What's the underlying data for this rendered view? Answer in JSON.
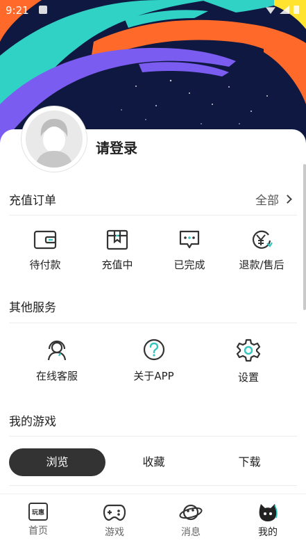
{
  "status_bar": {
    "time": "9:21"
  },
  "profile": {
    "login_text": "请登录",
    "avatar_icon": "default-avatar-icon"
  },
  "orders": {
    "title": "充值订单",
    "all_label": "全部",
    "items": [
      {
        "label": "待付款",
        "icon": "wallet-icon"
      },
      {
        "label": "充值中",
        "icon": "package-icon"
      },
      {
        "label": "已完成",
        "icon": "chat-dots-icon"
      },
      {
        "label": "退款/售后",
        "icon": "yuan-refund-icon"
      }
    ]
  },
  "services": {
    "title": "其他服务",
    "items": [
      {
        "label": "在线客服",
        "icon": "headset-icon"
      },
      {
        "label": "关于APP",
        "icon": "question-icon"
      },
      {
        "label": "设置",
        "icon": "gear-icon"
      }
    ]
  },
  "games": {
    "title": "我的游戏",
    "tabs": [
      {
        "label": "浏览",
        "active": true
      },
      {
        "label": "收藏",
        "active": false
      },
      {
        "label": "下载",
        "active": false
      }
    ]
  },
  "nav": {
    "items": [
      {
        "label": "首页",
        "icon": "home-wan-icon",
        "icon_text": "玩惠"
      },
      {
        "label": "游戏",
        "icon": "gamepad-icon"
      },
      {
        "label": "消息",
        "icon": "planet-icon"
      },
      {
        "label": "我的",
        "icon": "profile-cat-icon",
        "active": true
      }
    ]
  },
  "colors": {
    "teal": "#2fd2c4",
    "orange": "#ff6a2a",
    "purple": "#7b5cf0",
    "yellow": "#ffe32e",
    "dark_bg": "#0f1840",
    "accent_text": "#222222",
    "icon_teal": "#34c6c0"
  }
}
